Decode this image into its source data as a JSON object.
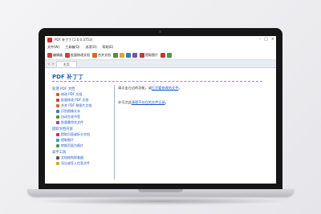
{
  "window": {
    "title": "PDF 补丁丁 [1.0.0.3753]",
    "controls": [
      "–",
      "□",
      "×"
    ]
  },
  "menu": [
    "文件(W)",
    "工具箱(Q)",
    "选项(O)",
    "帮助(E)"
  ],
  "toolbar": {
    "buttons": [
      {
        "label": "编辑器",
        "color": "#d8403a"
      },
      {
        "label": "批量修改文档",
        "color": "#c8423a"
      },
      {
        "label": "合并文档",
        "color": "#d46a2a"
      },
      {
        "label": "提取图片",
        "color": "#c23a3a"
      }
    ],
    "mini_icon_colors": [
      "#4f8f3a",
      "#d6a437",
      "#3b78c4",
      "#7a4fb2",
      "#c33",
      "#4a9b4a"
    ]
  },
  "tabs": {
    "nav_left": "<",
    "nav_right": ">",
    "items": [
      {
        "label": "主页"
      }
    ]
  },
  "brand": "PDF 补丁丁",
  "sidebar": {
    "sections": [
      {
        "title": "处理 PDF 文档",
        "items": [
          {
            "label": "修改 PDF 文档",
            "color": "#d35b2a"
          },
          {
            "label": "批量修改 PDF 文档",
            "color": "#c8423a"
          },
          {
            "label": "合并 PDF 和图片文档",
            "color": "#d46a2a"
          },
          {
            "label": "识别图像文本",
            "color": "#3b78c4"
          },
          {
            "label": "自动生成书签",
            "color": "#4f8f3a"
          },
          {
            "label": "批量重命名文件",
            "color": "#7a4fb2"
          }
        ]
      },
      {
        "title": "提取文档内容",
        "items": [
          {
            "label": "提取页面或拆分文档",
            "color": "#c33"
          },
          {
            "label": "提取图片",
            "color": "#3b9ad1"
          },
          {
            "label": "转换页面为图片",
            "color": "#4a9b4a"
          }
        ]
      },
      {
        "title": "高手工具",
        "items": [
          {
            "label": "文档结构探查器",
            "color": "#555"
          },
          {
            "label": "导出或导入信息文件",
            "color": "#d6a437"
          }
        ]
      }
    ]
  },
  "main": {
    "line1_prefix": "请点击左边的功能，或",
    "line1_link": "打开要修改的文件",
    "line1_suffix": "。",
    "line2_prefix": "亦可点此",
    "line2_link": "清理不存在的文件记录",
    "line2_suffix": "。"
  }
}
